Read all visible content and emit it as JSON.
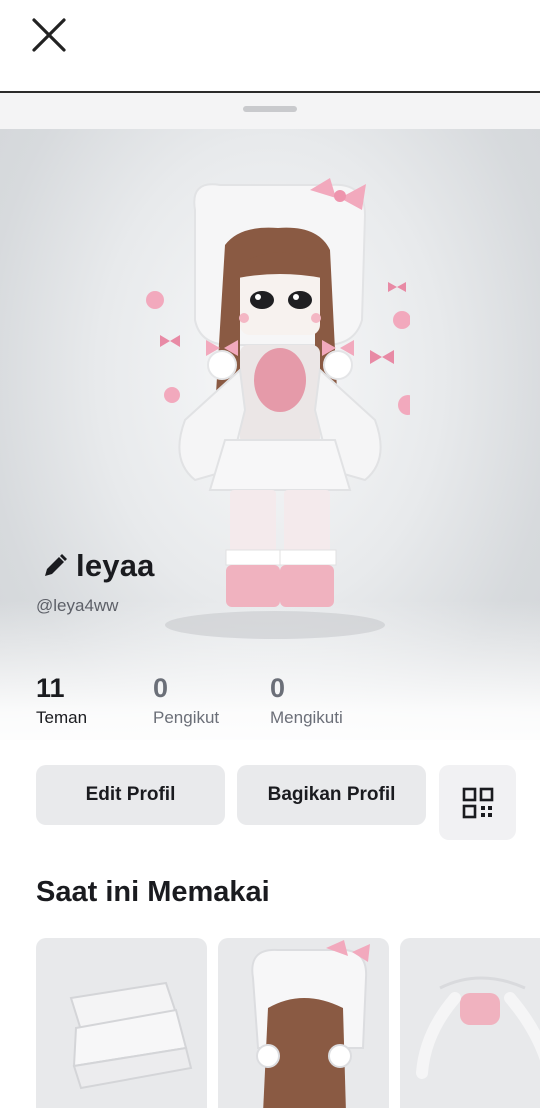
{
  "header": {
    "close_icon": "close-icon"
  },
  "profile": {
    "display_name": "leyaa",
    "username": "@leya4ww",
    "edit_icon": "pencil-icon"
  },
  "stats": [
    {
      "value": "11",
      "label": "Teman"
    },
    {
      "value": "0",
      "label": "Pengikut"
    },
    {
      "value": "0",
      "label": "Mengikuti"
    }
  ],
  "actions": {
    "edit_label": "Edit Profil",
    "share_label": "Bagikan Profil",
    "qr_icon": "qr-code-icon"
  },
  "wearing": {
    "title": "Saat ini Memakai",
    "items": [
      {
        "icon": "skirt-item-thumbnail"
      },
      {
        "icon": "hair-hat-item-thumbnail"
      },
      {
        "icon": "pigtails-item-thumbnail"
      }
    ]
  },
  "colors": {
    "accent_pink": "#f2a9bd",
    "text_primary": "#1a1b1f",
    "text_muted": "#6b6f78",
    "button_bg": "#e9eaec"
  }
}
